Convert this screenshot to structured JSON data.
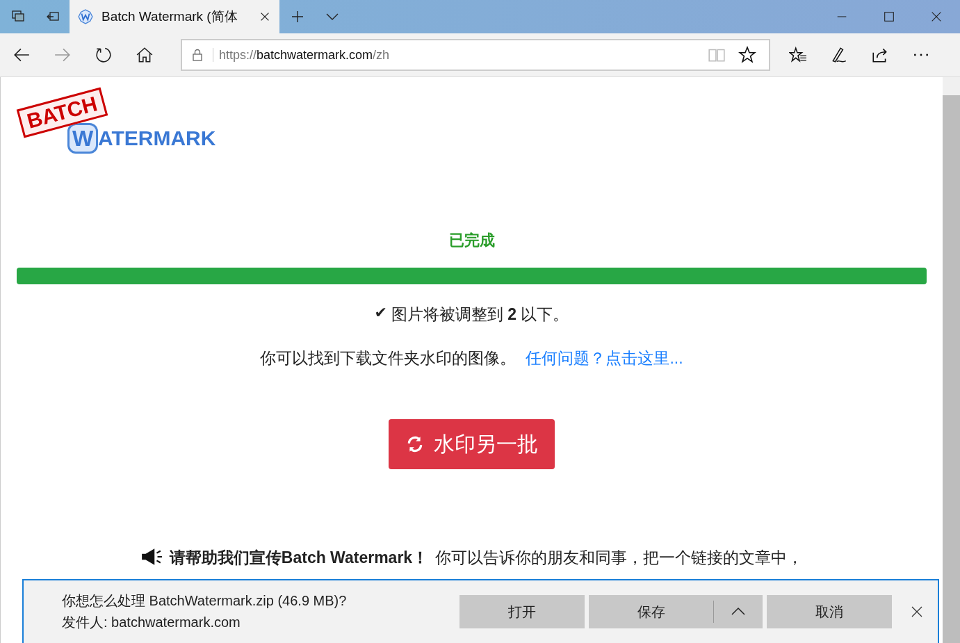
{
  "tab": {
    "title": "Batch Watermark (简体"
  },
  "address": {
    "protocol": "https://",
    "domain": "batchwatermark.com",
    "path": "/zh"
  },
  "logo": {
    "top": "BATCH",
    "letter": "W",
    "rest": "ATERMARK"
  },
  "status": "已完成",
  "progress": {
    "level": 1
  },
  "note": {
    "check": "✔",
    "text": "图片将被调整到 **2** 以下。"
  },
  "info": {
    "text": "你可以找到下载文件夹水印的图像。",
    "link": "任何问题？点击这里..."
  },
  "button": {
    "label": "水印另一批"
  },
  "promo": {
    "bold": "请帮助我们宣传Batch Watermark！",
    "text": "你可以告诉你的朋友和同事，把一个链接的文章中，"
  },
  "download": {
    "question": "你想怎么处理 BatchWatermark.zip (46.9 MB)?",
    "sender": "发件人: batchwatermark.com",
    "buttons": [
      {
        "label": "打开",
        "kind": "plain"
      },
      {
        "label": "保存",
        "kind": "split"
      },
      {
        "label": "取消",
        "kind": "plain"
      }
    ]
  }
}
